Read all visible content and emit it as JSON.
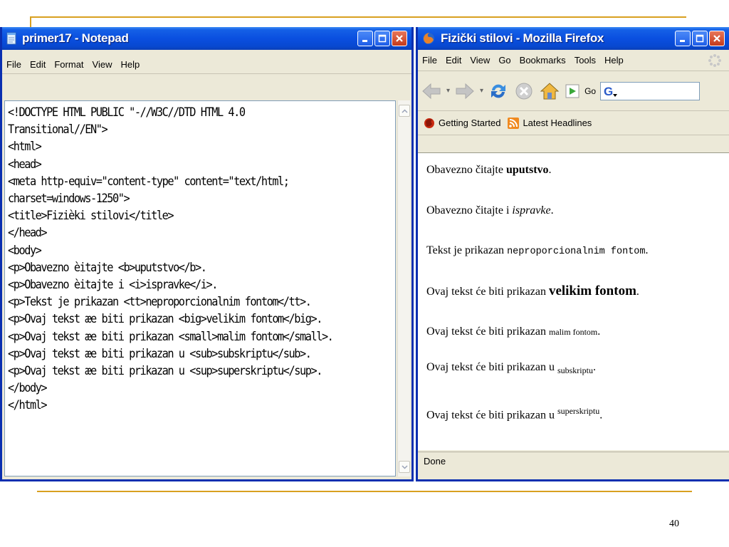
{
  "slide": {
    "page_number": "40"
  },
  "notepad": {
    "title": "primer17 - Notepad",
    "menu": [
      "File",
      "Edit",
      "Format",
      "View",
      "Help"
    ],
    "content": "<!DOCTYPE HTML PUBLIC \"-//W3C//DTD HTML 4.0\nTransitional//EN\">\n<html>\n<head>\n<meta http-equiv=\"content-type\" content=\"text/html;\ncharset=windows-1250\">\n<title>Fizièki stilovi</title>\n</head>\n<body>\n<p>Obavezno èitajte <b>uputstvo</b>.\n<p>Obavezno èitajte i <i>ispravke</i>.\n<p>Tekst je prikazan <tt>neproporcionalnim fontom</tt>.\n<p>Ovaj tekst æe biti prikazan <big>velikim fontom</big>.\n<p>Ovaj tekst æe biti prikazan <small>malim fontom</small>.\n<p>Ovaj tekst æe biti prikazan u <sub>subskriptu</sub>.\n<p>Ovaj tekst æe biti prikazan u <sup>superskriptu</sup>.\n</body>\n</html>"
  },
  "firefox": {
    "title": "Fizički stilovi - Mozilla Firefox",
    "menu": [
      "File",
      "Edit",
      "View",
      "Go",
      "Bookmarks",
      "Tools",
      "Help"
    ],
    "go_label": "Go",
    "bookmarks": [
      "Getting Started",
      "Latest Headlines"
    ],
    "status": "Done",
    "page": {
      "p1_pre": "Obavezno čitajte ",
      "p1_bold": "uputstvo",
      "p1_post": ".",
      "p2_pre": "Obavezno čitajte i ",
      "p2_italic": "ispravke",
      "p2_post": ".",
      "p3_pre": "Tekst je prikazan ",
      "p3_tt": "neproporcionalnim fontom",
      "p3_post": ".",
      "p4_pre": "Ovaj tekst će biti prikazan ",
      "p4_big": "velikim fontom",
      "p4_post": ".",
      "p5_pre": "Ovaj tekst će biti prikazan ",
      "p5_small": "malim fontom",
      "p5_post": ".",
      "p6_pre": "Ovaj tekst će biti prikazan u ",
      "p6_sub": "subskriptu",
      "p6_post": ".",
      "p7_pre": "Ovaj tekst će biti prikazan u ",
      "p7_sup": "superskriptu",
      "p7_post": "."
    }
  }
}
